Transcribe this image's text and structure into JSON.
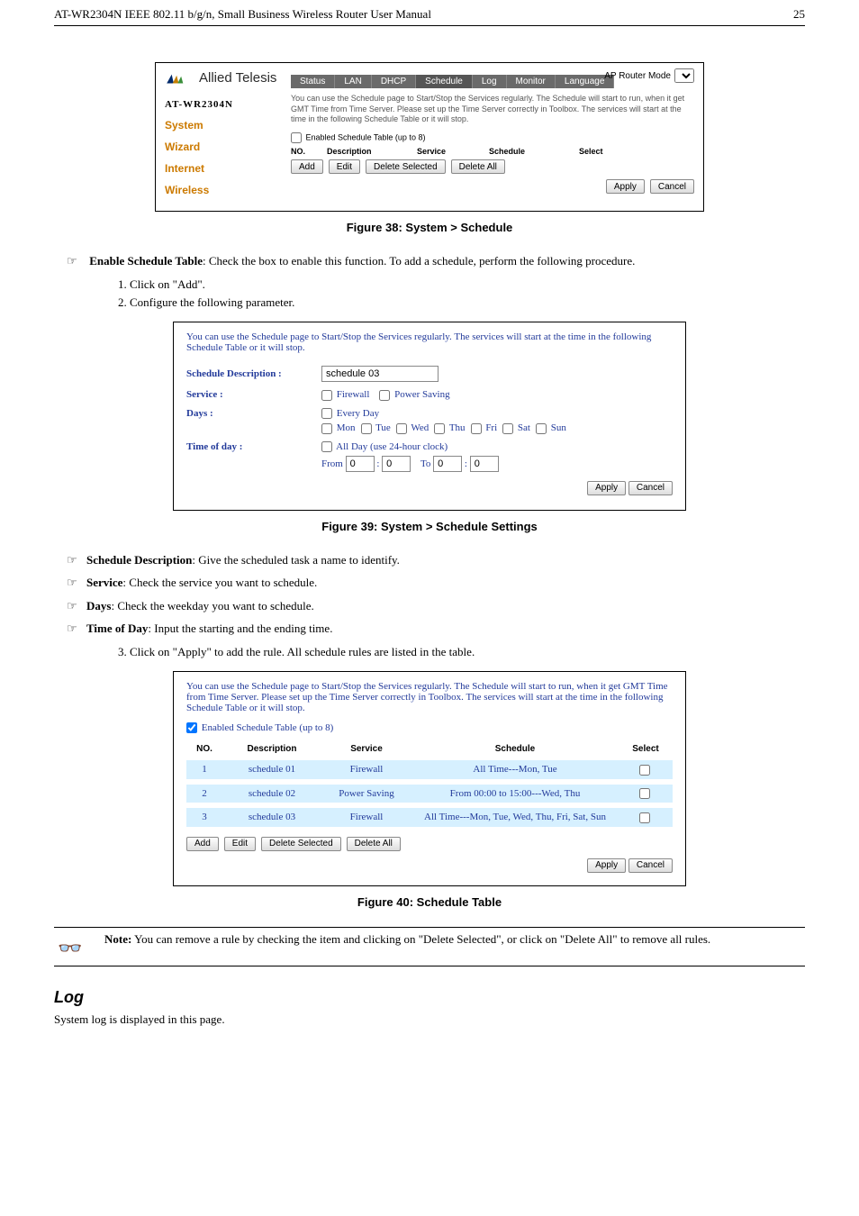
{
  "header": {
    "title": "AT-WR2304N IEEE 802.11 b/g/n, Small Business Wireless Router User Manual",
    "page": "25"
  },
  "fig38": {
    "ap_mode_label": "AP Router Mode",
    "logo_text": "Allied Telesis",
    "tabs": [
      "Status",
      "LAN",
      "DHCP",
      "Schedule",
      "Log",
      "Monitor",
      "Language"
    ],
    "model": "AT-WR2304N",
    "side": [
      "System",
      "Wizard",
      "Internet",
      "Wireless"
    ],
    "desc": "You can use the Schedule page to Start/Stop the Services regularly. The Schedule will start to run, when it get GMT Time from Time Server. Please set up the Time Server correctly in Toolbox. The services will start at the time in the following Schedule Table or it will stop.",
    "enable_label": "Enabled Schedule Table (up to 8)",
    "cols": {
      "no": "NO.",
      "desc": "Description",
      "service": "Service",
      "schedule": "Schedule",
      "select": "Select"
    },
    "buttons": {
      "add": "Add",
      "edit": "Edit",
      "del": "Delete Selected",
      "delall": "Delete All",
      "apply": "Apply",
      "cancel": "Cancel"
    },
    "caption": "Figure 38: System > Schedule"
  },
  "enable_bullet": {
    "label": "Enable Schedule Table",
    "text": ": Check the box to enable this function. To add a schedule, perform the following procedure."
  },
  "steps1": [
    "Click on \"Add\".",
    "Configure the following parameter."
  ],
  "fig39": {
    "intro": "You can use the Schedule page to Start/Stop the Services regularly. The services will start at the time in the following Schedule Table or it will stop.",
    "rows": {
      "sched_desc_label": "Schedule Description :",
      "sched_desc_value": "schedule 03",
      "service_label": "Service :",
      "service_opts": [
        "Firewall",
        "Power Saving"
      ],
      "days_label": "Days :",
      "every_day": "Every Day",
      "days": [
        "Mon",
        "Tue",
        "Wed",
        "Thu",
        "Fri",
        "Sat",
        "Sun"
      ],
      "tod_label": "Time of day :",
      "all_day": "All Day (use 24-hour clock)",
      "from": "From",
      "to": "To",
      "colon": ":",
      "from_h": "0",
      "from_m": "0",
      "to_h": "0",
      "to_m": "0"
    },
    "apply": "Apply",
    "cancel": "Cancel",
    "caption": "Figure 39: System > Schedule Settings"
  },
  "bullets2": [
    {
      "label": "Schedule Description",
      "text": ": Give the scheduled task a name to identify."
    },
    {
      "label": "Service",
      "text": ": Check the service you want to schedule."
    },
    {
      "label": "Days",
      "text": ": Check the weekday you want to schedule."
    },
    {
      "label": "Time of Day",
      "text": ": Input the starting and the ending time."
    }
  ],
  "step3": "Click on \"Apply\" to add the rule. All schedule rules are listed in the table.",
  "fig40": {
    "intro": "You can use the Schedule page to Start/Stop the Services regularly. The Schedule will start to run, when it get GMT Time from Time Server. Please set up the Time Server correctly in Toolbox. The services will start at the time in the following Schedule Table or it will stop.",
    "enable_label": "Enabled Schedule Table (up to 8)",
    "cols": {
      "no": "NO.",
      "desc": "Description",
      "service": "Service",
      "schedule": "Schedule",
      "select": "Select"
    },
    "rows": [
      {
        "no": "1",
        "desc": "schedule 01",
        "service": "Firewall",
        "schedule": "All Time---Mon, Tue"
      },
      {
        "no": "2",
        "desc": "schedule 02",
        "service": "Power Saving",
        "schedule": "From 00:00 to 15:00---Wed, Thu"
      },
      {
        "no": "3",
        "desc": "schedule 03",
        "service": "Firewall",
        "schedule": "All Time---Mon, Tue, Wed, Thu, Fri, Sat, Sun"
      }
    ],
    "buttons": {
      "add": "Add",
      "edit": "Edit",
      "del": "Delete Selected",
      "delall": "Delete All",
      "apply": "Apply",
      "cancel": "Cancel"
    },
    "caption": "Figure 40: Schedule Table"
  },
  "note": {
    "label": "Note:",
    "text": " You can remove a rule by checking the item and clicking on \"Delete Selected\", or click on \"Delete All\" to remove all rules."
  },
  "log": {
    "heading": "Log",
    "text": "System log is displayed in this page."
  }
}
